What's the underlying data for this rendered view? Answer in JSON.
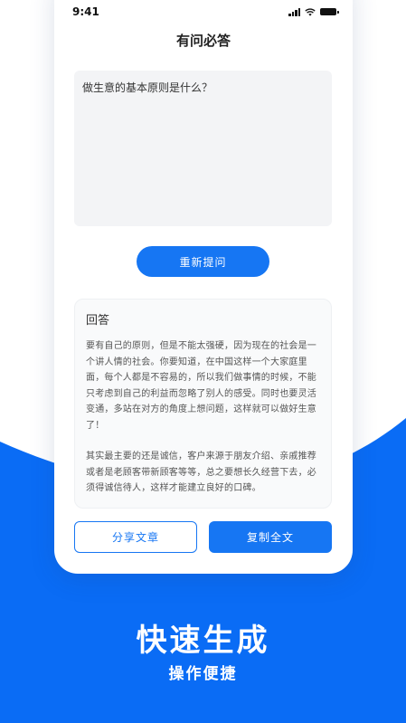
{
  "status_bar": {
    "time": "9:41"
  },
  "header": {
    "title": "有问必答"
  },
  "question": {
    "text": "做生意的基本原则是什么？"
  },
  "reask_button": {
    "label": "重新提问"
  },
  "answer": {
    "heading": "回答",
    "paragraphs": [
      "要有自己的原则，但是不能太强硬，因为现在的社会是一个讲人情的社会。你要知道，在中国这样一个大家庭里面，每个人都是不容易的，所以我们做事情的时候，不能只考虑到自己的利益而忽略了别人的感受。同时也要灵活变通，多站在对方的角度上想问题，这样就可以做好生意了！",
      "其实最主要的还是诚信，客户来源于朋友介绍、亲戚推荐或者是老顾客带新顾客等等，总之要想长久经营下去，必须得诚信待人，这样才能建立良好的口碑。"
    ]
  },
  "actions": {
    "share_label": "分享文章",
    "copy_label": "复制全文"
  },
  "promo": {
    "title": "快速生成",
    "subtitle": "操作便捷"
  },
  "colors": {
    "accent": "#1676f3",
    "background_blue": "#0a6cf5"
  },
  "icons": [
    "signal-icon",
    "wifi-icon",
    "battery-icon"
  ]
}
